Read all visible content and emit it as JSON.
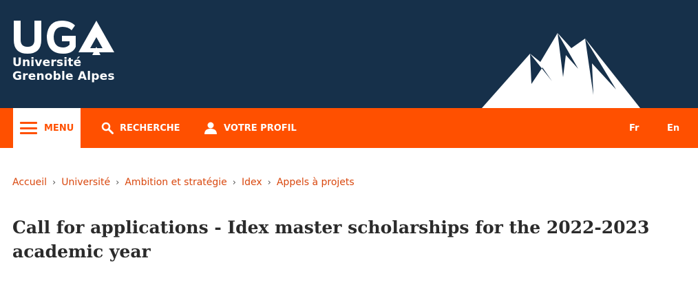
{
  "logo": {
    "line1": "Université",
    "line2": "Grenoble Alpes",
    "mark_text": "UGA"
  },
  "nav": {
    "menu_label": "MENU",
    "search_label": "RECHERCHE",
    "profile_label": "VOTRE PROFIL",
    "lang_fr": "Fr",
    "lang_en": "En"
  },
  "breadcrumb": [
    "Accueil",
    "Université",
    "Ambition et stratégie",
    "Idex",
    "Appels à projets"
  ],
  "page": {
    "title": "Call for applications - Idex master scholarships for the 2022-2023 academic year"
  },
  "colors": {
    "header_bg": "#16304a",
    "accent": "#ff5000",
    "breadcrumb": "#d9480f",
    "title": "#2b2b2b"
  },
  "icons": [
    "hamburger-icon",
    "search-icon",
    "user-icon",
    "chevron-right-icon",
    "mountain-icon"
  ]
}
